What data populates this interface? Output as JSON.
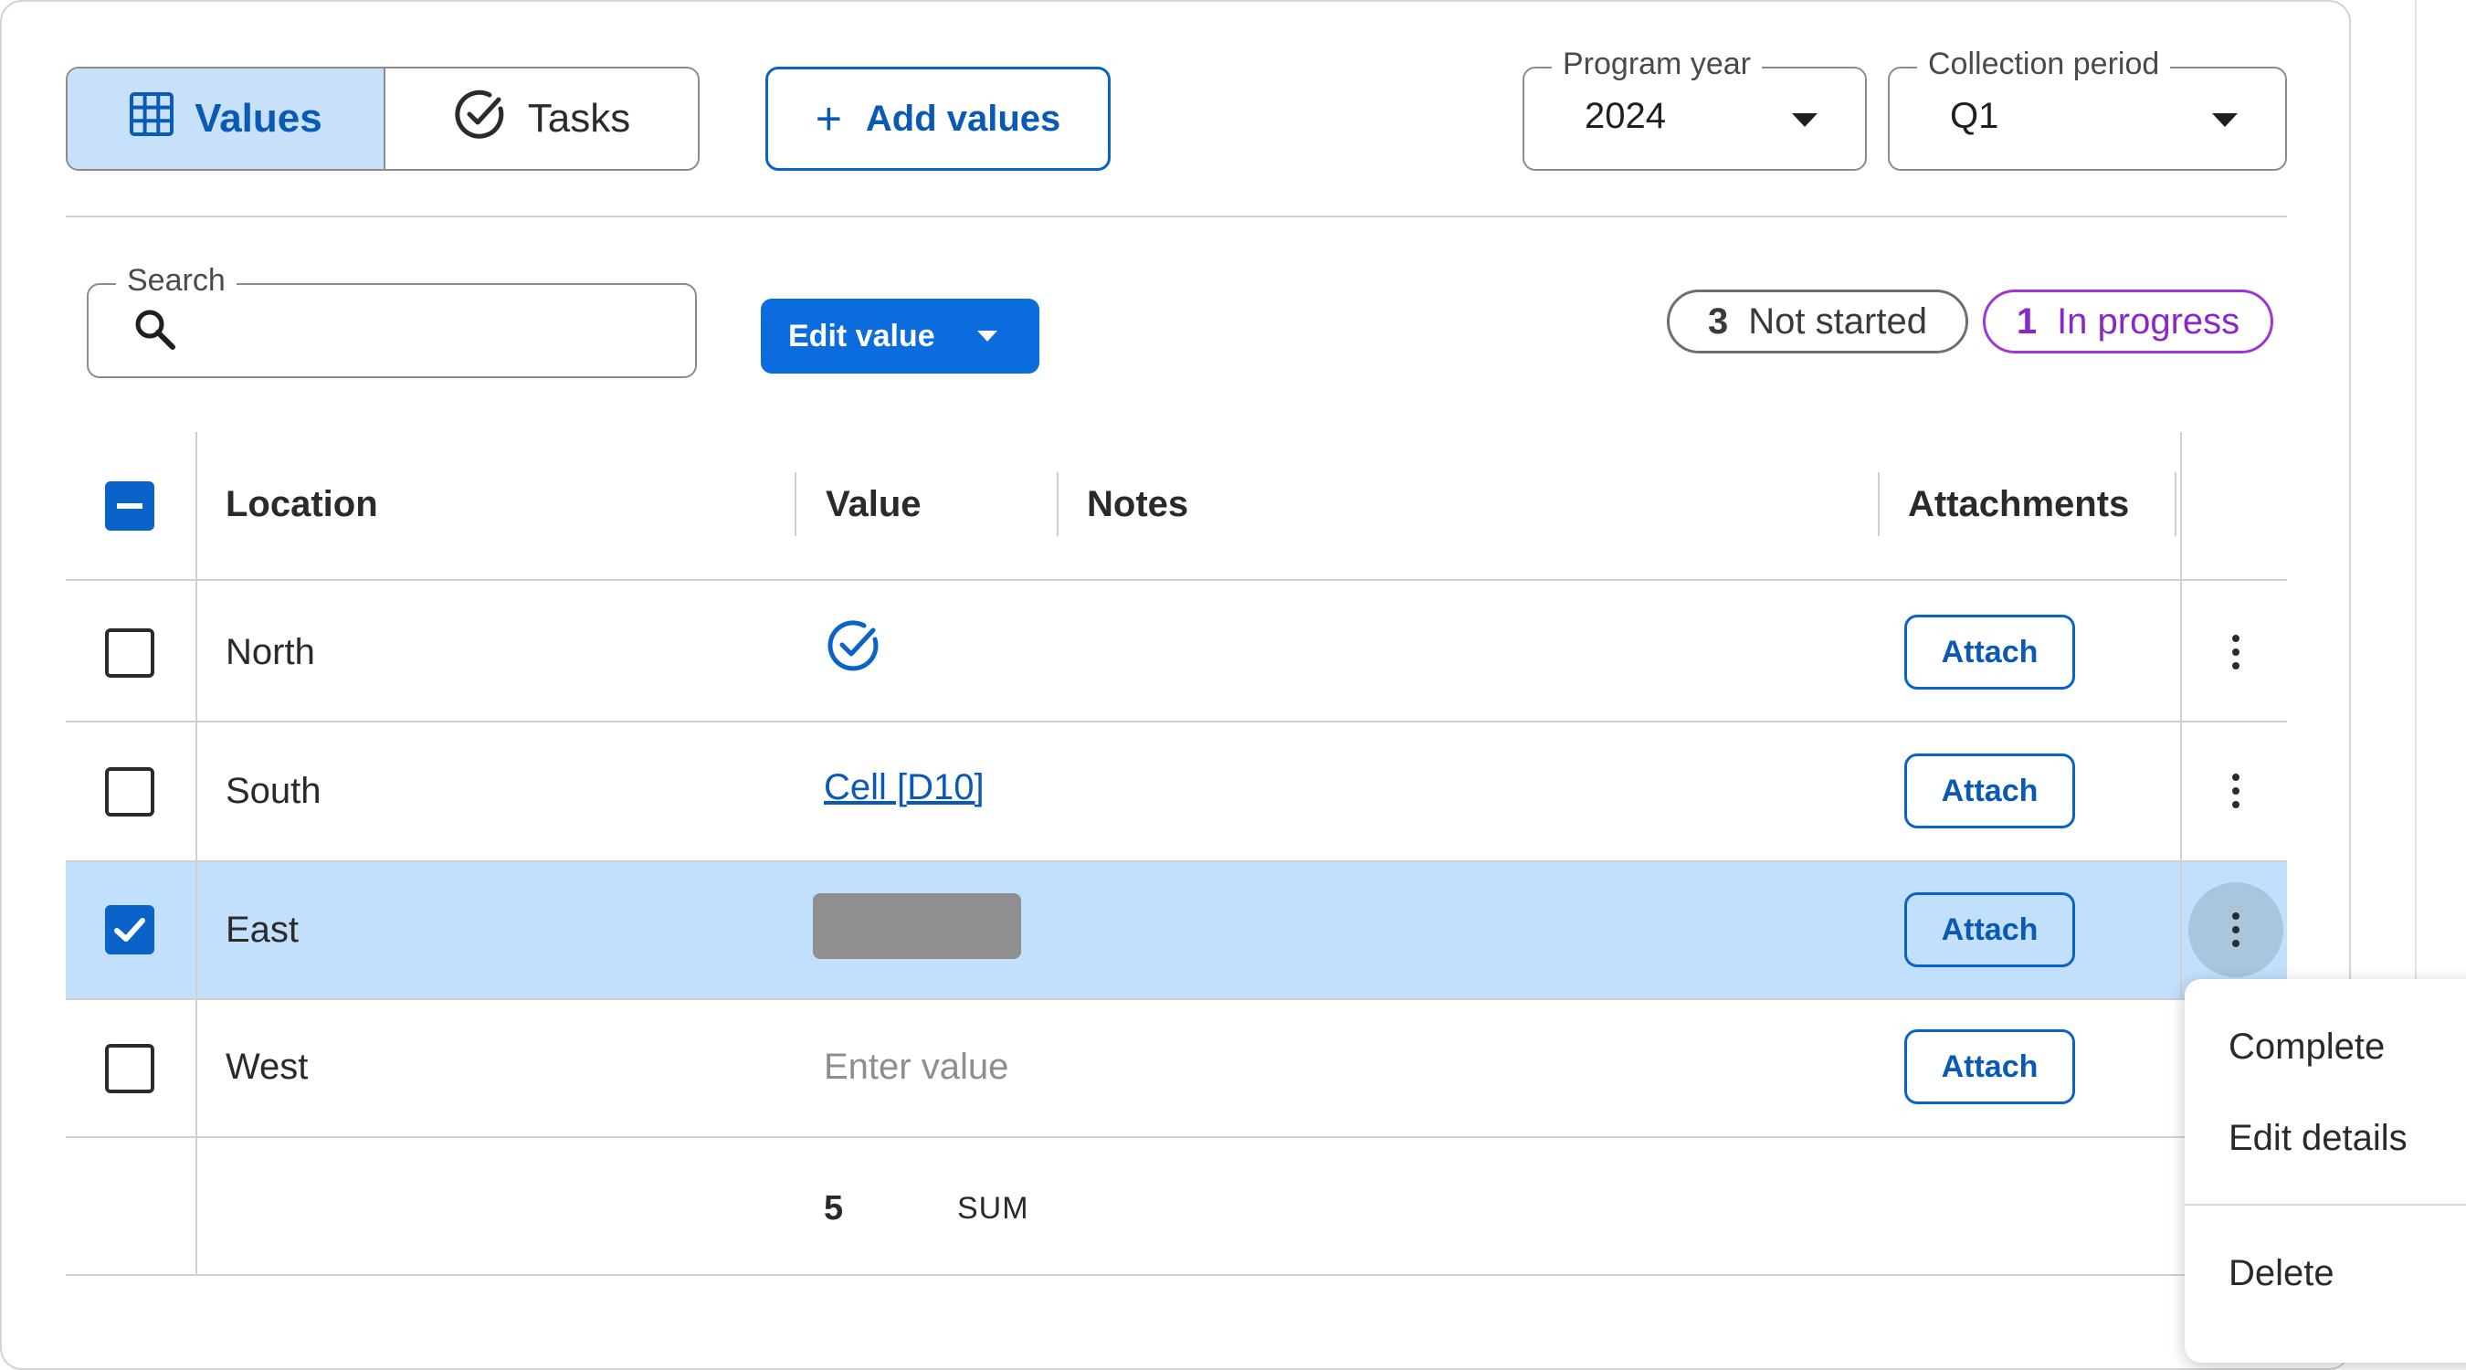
{
  "toolbar": {
    "tabs": [
      {
        "label": "Values",
        "icon": "grid-icon",
        "active": true
      },
      {
        "label": "Tasks",
        "icon": "check-circle-icon",
        "active": false
      }
    ],
    "add_values_label": "Add values",
    "program_year": {
      "label": "Program year",
      "value": "2024"
    },
    "collection_period": {
      "label": "Collection period",
      "value": "Q1"
    }
  },
  "filters": {
    "search_label": "Search",
    "search_value": "",
    "edit_value_label": "Edit value",
    "status_counts": [
      {
        "count": "3",
        "label": "Not started",
        "color": "#6e6e6e"
      },
      {
        "count": "1",
        "label": "In progress",
        "color": "#9c36d9"
      }
    ]
  },
  "table": {
    "headers": {
      "location": "Location",
      "value": "Value",
      "notes": "Notes",
      "attachments": "Attachments"
    },
    "rows": [
      {
        "location": "North",
        "value_type": "completed-check",
        "checked": false,
        "attach_label": "Attach"
      },
      {
        "location": "South",
        "value": "Cell [D10]",
        "value_type": "link",
        "checked": false,
        "attach_label": "Attach"
      },
      {
        "location": "East",
        "value_type": "redacted",
        "checked": true,
        "attach_label": "Attach"
      },
      {
        "location": "West",
        "value_placeholder": "Enter value",
        "value_type": "input",
        "checked": false,
        "attach_label": "Attach"
      }
    ],
    "footer": {
      "value": "5",
      "aggregate": "SUM"
    }
  },
  "context_menu": {
    "items": [
      "Complete",
      "Edit details",
      "Delete"
    ]
  },
  "colors": {
    "accent": "#0a63c9",
    "selected_row": "#c2e0fc",
    "active_tab": "#c8e1fb"
  }
}
